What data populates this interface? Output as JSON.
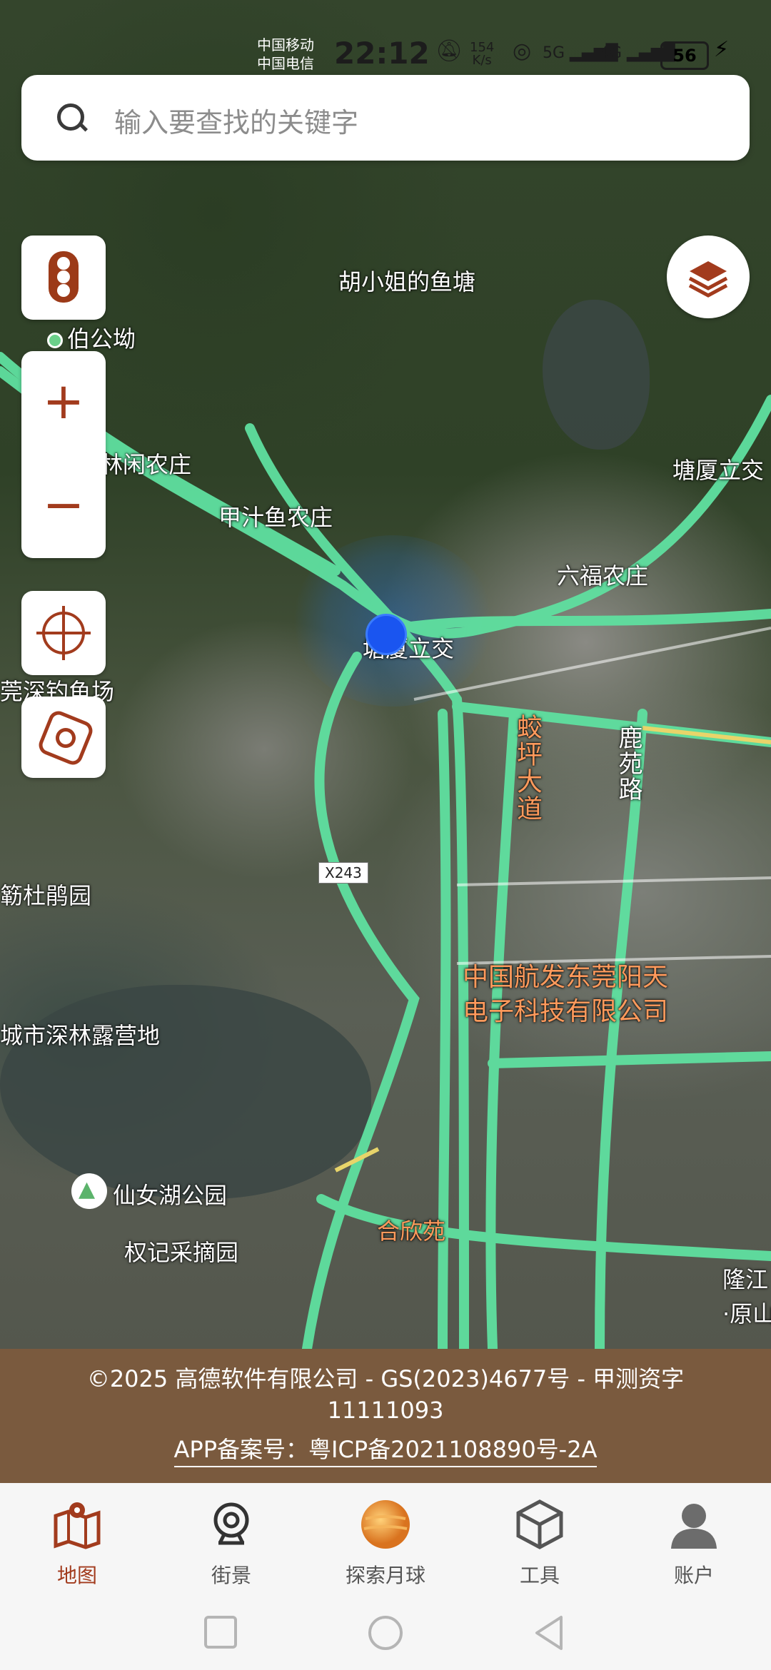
{
  "status_bar": {
    "carrier_1": "中国移动",
    "carrier_2": "中国电信",
    "time": "22:12",
    "net_speed_value": "154",
    "net_speed_unit": "K/s",
    "battery": "56"
  },
  "search": {
    "placeholder": "输入要查找的关键字"
  },
  "map": {
    "labels": {
      "fish_pond": "胡小姐的鱼塘",
      "bogong": "伯公坳",
      "linxian": "林闲农庄",
      "tangxia_right": "塘厦立交",
      "jiazhi": "甲汁鱼农庄",
      "liufu": "六福农庄",
      "tangxia_center": "塘厦立交",
      "shenzhen_fishing": "莞深钓鱼场",
      "jiaoping": "蛟坪大道",
      "luyuan": "鹿苑路",
      "dujuan": "簕杜鹃园",
      "company_line1": "中国航发东莞阳天",
      "company_line2": "电子科技有限公司",
      "camp": "城市深林露营地",
      "xiannvhu": "仙女湖公园",
      "quanji": "权记采摘园",
      "hexin": "合欣苑",
      "longjiang": "隆江",
      "yuan": "·原山"
    },
    "route_shield": "X243"
  },
  "copyright": {
    "line1": "©2025 高德软件有限公司 - GS(2023)4677号 - 甲测资字11111093",
    "line2": "APP备案号：粤ICP备2021108890号-2A"
  },
  "tabs": [
    {
      "label": "地图",
      "icon": "map-icon",
      "active": true
    },
    {
      "label": "街景",
      "icon": "street-view-icon",
      "active": false
    },
    {
      "label": "探索月球",
      "icon": "moon-icon",
      "active": false
    },
    {
      "label": "工具",
      "icon": "cube-icon",
      "active": false
    },
    {
      "label": "账户",
      "icon": "account-icon",
      "active": false
    }
  ],
  "colors": {
    "accent": "#a23b1d",
    "road": "#5fe0a0",
    "copyright_bg": "#7a5a3e",
    "location_dot": "#1a55f0"
  }
}
